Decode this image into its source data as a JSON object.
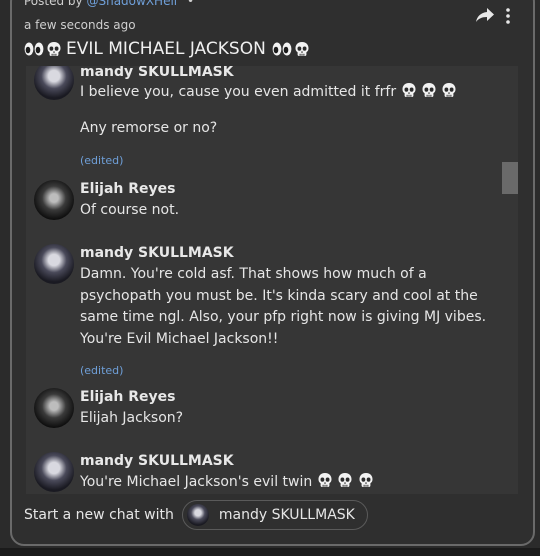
{
  "post": {
    "posted_prefix": "Posted by",
    "posted_handle": "@ShadowXHell",
    "posted_dot": "•",
    "time": "a few seconds ago",
    "title": "EVIL MICHAEL JACKSON"
  },
  "messages": [
    {
      "author": "mandy SKULLMASK",
      "line1": "I believe you, cause you even admitted it frfr",
      "line2": "Any remorse or no?",
      "edited": "(edited)"
    },
    {
      "author": "Elijah Reyes",
      "text": "Of course not."
    },
    {
      "author": "mandy SKULLMASK",
      "text": "Damn. You're cold asf. That shows how much of a psychopath you must be. It's kinda scary and cool at the same time ngl. Also, your pfp right now is giving MJ vibes. You're Evil Michael Jackson!!",
      "edited": "(edited)"
    },
    {
      "author": "Elijah Reyes",
      "text": "Elijah Jackson?"
    },
    {
      "author": "mandy SKULLMASK",
      "text": "You're Michael Jackson's evil twin"
    }
  ],
  "footer": {
    "start_label": "Start a new chat with",
    "chip_label": "mandy SKULLMASK"
  },
  "icons": {
    "share": "share-arrow-icon",
    "menu": "kebab-menu-icon",
    "skull": "skull-emoji-icon",
    "eyes": "eyes-emoji-icon"
  },
  "colors": {
    "link": "#6f9fd8",
    "background": "#2f2f2f",
    "chat_bg": "#363636"
  }
}
